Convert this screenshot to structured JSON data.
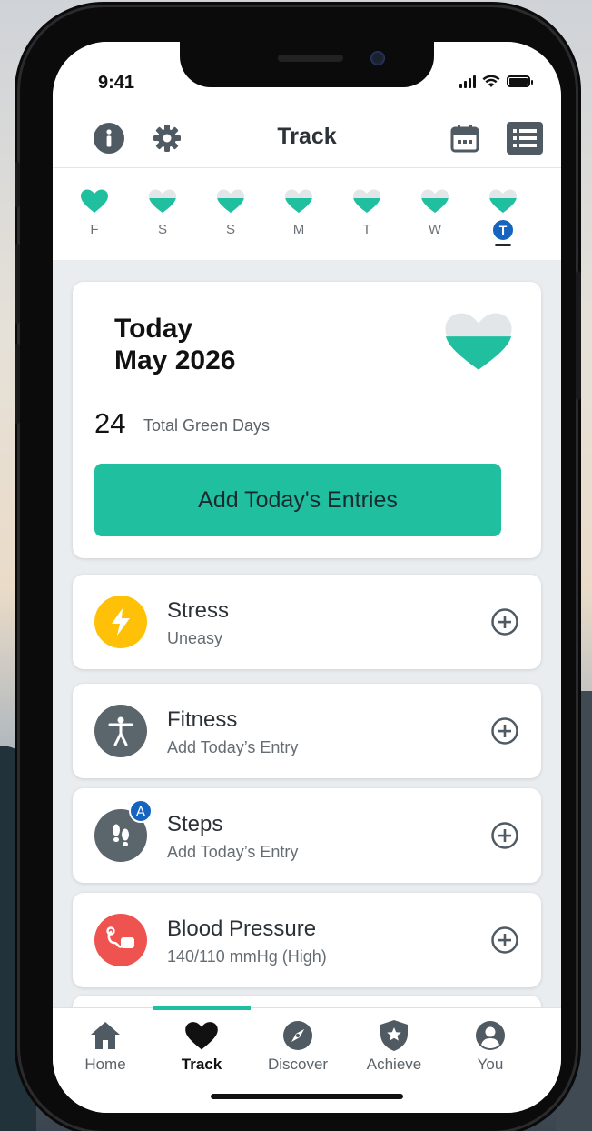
{
  "status_bar": {
    "time": "9:41"
  },
  "header": {
    "title": "Track"
  },
  "week": {
    "days": [
      {
        "label": "F",
        "fill": 1.0
      },
      {
        "label": "S",
        "fill": 0.5
      },
      {
        "label": "S",
        "fill": 0.5
      },
      {
        "label": "M",
        "fill": 0.5
      },
      {
        "label": "T",
        "fill": 0.5
      },
      {
        "label": "W",
        "fill": 0.5
      },
      {
        "label": "T",
        "fill": 0.5,
        "today": true
      }
    ]
  },
  "summary": {
    "title_line1": "Today",
    "title_line2": "May 2026",
    "green_days_count": "24",
    "green_days_label": "Total Green Days",
    "add_button_label": "Add Today's Entries",
    "heart_fill": 0.5
  },
  "entries": [
    {
      "name": "Stress",
      "sub": "Uneasy",
      "color": "#ffc107",
      "icon": "lightning-icon"
    },
    {
      "name": "Fitness",
      "sub": "Add Today’s Entry",
      "color": "#5b656c",
      "icon": "person-icon"
    },
    {
      "name": "Steps",
      "sub": "Add Today’s Entry",
      "color": "#5b656c",
      "icon": "footprints-icon",
      "badge": "A"
    },
    {
      "name": "Blood Pressure",
      "sub": "140/110 mmHg (High)",
      "color": "#ef5350",
      "icon": "blood-pressure-icon"
    }
  ],
  "tabs": [
    {
      "label": "Home",
      "icon": "home-icon"
    },
    {
      "label": "Track",
      "icon": "heart-icon",
      "active": true
    },
    {
      "label": "Discover",
      "icon": "compass-icon"
    },
    {
      "label": "Achieve",
      "icon": "shield-star-icon"
    },
    {
      "label": "You",
      "icon": "user-icon"
    }
  ],
  "colors": {
    "accent": "#1fbf9f",
    "today_badge": "#1565c0"
  }
}
